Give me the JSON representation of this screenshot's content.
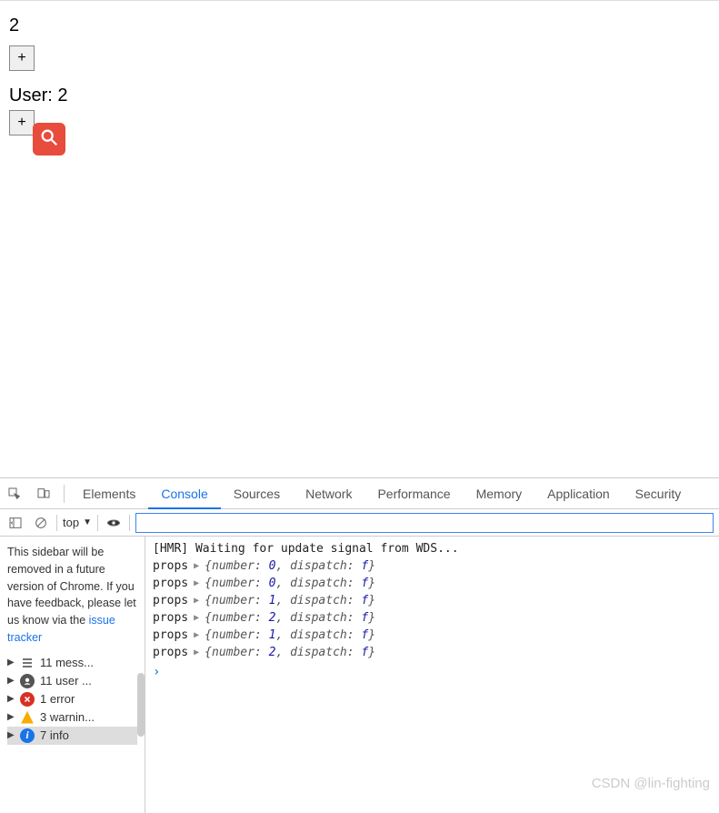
{
  "page": {
    "counter1_value": "2",
    "plus_label": "+",
    "user_prefix": "User: ",
    "user_value": "2"
  },
  "devtools": {
    "tabs": {
      "elements": "Elements",
      "console": "Console",
      "sources": "Sources",
      "network": "Network",
      "performance": "Performance",
      "memory": "Memory",
      "application": "Application",
      "security": "Security"
    },
    "toolbar": {
      "context": "top",
      "filter_placeholder": ""
    },
    "sidebar": {
      "notice": "This sidebar will be removed in a future version of Chrome. If you have feedback, please let us know via the ",
      "notice_link": "issue tracker",
      "categories": [
        {
          "icon": "list",
          "label": "11 mess..."
        },
        {
          "icon": "user",
          "label": "11 user ..."
        },
        {
          "icon": "error",
          "label": "1 error"
        },
        {
          "icon": "warn",
          "label": "3 warnin..."
        },
        {
          "icon": "info",
          "label": "7 info"
        }
      ]
    },
    "console": {
      "hmr_line": "[HMR] Waiting for update signal from WDS...",
      "prop_label": "props",
      "entries": [
        {
          "number": "0"
        },
        {
          "number": "0"
        },
        {
          "number": "1"
        },
        {
          "number": "2"
        },
        {
          "number": "1"
        },
        {
          "number": "2"
        }
      ],
      "obj_open": "{number: ",
      "obj_mid": ", dispatch: ",
      "obj_fn": "f",
      "obj_close": "}",
      "prompt": "›"
    }
  },
  "watermark": "CSDN @lin-fighting"
}
